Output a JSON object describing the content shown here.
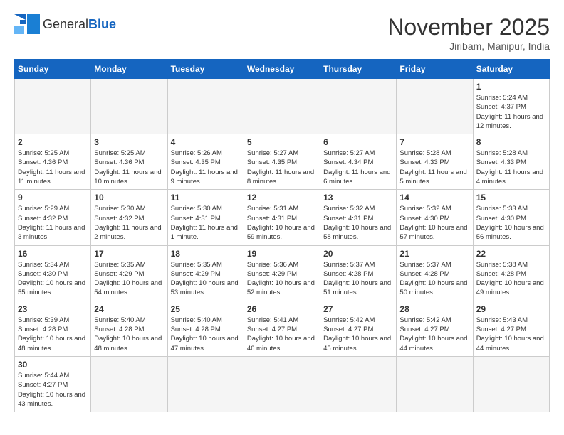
{
  "header": {
    "logo_general": "General",
    "logo_blue": "Blue",
    "month_title": "November 2025",
    "location": "Jiribam, Manipur, India"
  },
  "weekdays": [
    "Sunday",
    "Monday",
    "Tuesday",
    "Wednesday",
    "Thursday",
    "Friday",
    "Saturday"
  ],
  "weeks": [
    [
      {
        "day": "",
        "empty": true
      },
      {
        "day": "",
        "empty": true
      },
      {
        "day": "",
        "empty": true
      },
      {
        "day": "",
        "empty": true
      },
      {
        "day": "",
        "empty": true
      },
      {
        "day": "",
        "empty": true
      },
      {
        "day": "1",
        "info": "Sunrise: 5:24 AM\nSunset: 4:37 PM\nDaylight: 11 hours and 12 minutes."
      }
    ],
    [
      {
        "day": "2",
        "info": "Sunrise: 5:25 AM\nSunset: 4:36 PM\nDaylight: 11 hours and 11 minutes."
      },
      {
        "day": "3",
        "info": "Sunrise: 5:25 AM\nSunset: 4:36 PM\nDaylight: 11 hours and 10 minutes."
      },
      {
        "day": "4",
        "info": "Sunrise: 5:26 AM\nSunset: 4:35 PM\nDaylight: 11 hours and 9 minutes."
      },
      {
        "day": "5",
        "info": "Sunrise: 5:27 AM\nSunset: 4:35 PM\nDaylight: 11 hours and 8 minutes."
      },
      {
        "day": "6",
        "info": "Sunrise: 5:27 AM\nSunset: 4:34 PM\nDaylight: 11 hours and 6 minutes."
      },
      {
        "day": "7",
        "info": "Sunrise: 5:28 AM\nSunset: 4:33 PM\nDaylight: 11 hours and 5 minutes."
      },
      {
        "day": "8",
        "info": "Sunrise: 5:28 AM\nSunset: 4:33 PM\nDaylight: 11 hours and 4 minutes."
      }
    ],
    [
      {
        "day": "9",
        "info": "Sunrise: 5:29 AM\nSunset: 4:32 PM\nDaylight: 11 hours and 3 minutes."
      },
      {
        "day": "10",
        "info": "Sunrise: 5:30 AM\nSunset: 4:32 PM\nDaylight: 11 hours and 2 minutes."
      },
      {
        "day": "11",
        "info": "Sunrise: 5:30 AM\nSunset: 4:31 PM\nDaylight: 11 hours and 1 minute."
      },
      {
        "day": "12",
        "info": "Sunrise: 5:31 AM\nSunset: 4:31 PM\nDaylight: 10 hours and 59 minutes."
      },
      {
        "day": "13",
        "info": "Sunrise: 5:32 AM\nSunset: 4:31 PM\nDaylight: 10 hours and 58 minutes."
      },
      {
        "day": "14",
        "info": "Sunrise: 5:32 AM\nSunset: 4:30 PM\nDaylight: 10 hours and 57 minutes."
      },
      {
        "day": "15",
        "info": "Sunrise: 5:33 AM\nSunset: 4:30 PM\nDaylight: 10 hours and 56 minutes."
      }
    ],
    [
      {
        "day": "16",
        "info": "Sunrise: 5:34 AM\nSunset: 4:30 PM\nDaylight: 10 hours and 55 minutes."
      },
      {
        "day": "17",
        "info": "Sunrise: 5:35 AM\nSunset: 4:29 PM\nDaylight: 10 hours and 54 minutes."
      },
      {
        "day": "18",
        "info": "Sunrise: 5:35 AM\nSunset: 4:29 PM\nDaylight: 10 hours and 53 minutes."
      },
      {
        "day": "19",
        "info": "Sunrise: 5:36 AM\nSunset: 4:29 PM\nDaylight: 10 hours and 52 minutes."
      },
      {
        "day": "20",
        "info": "Sunrise: 5:37 AM\nSunset: 4:28 PM\nDaylight: 10 hours and 51 minutes."
      },
      {
        "day": "21",
        "info": "Sunrise: 5:37 AM\nSunset: 4:28 PM\nDaylight: 10 hours and 50 minutes."
      },
      {
        "day": "22",
        "info": "Sunrise: 5:38 AM\nSunset: 4:28 PM\nDaylight: 10 hours and 49 minutes."
      }
    ],
    [
      {
        "day": "23",
        "info": "Sunrise: 5:39 AM\nSunset: 4:28 PM\nDaylight: 10 hours and 48 minutes."
      },
      {
        "day": "24",
        "info": "Sunrise: 5:40 AM\nSunset: 4:28 PM\nDaylight: 10 hours and 48 minutes."
      },
      {
        "day": "25",
        "info": "Sunrise: 5:40 AM\nSunset: 4:28 PM\nDaylight: 10 hours and 47 minutes."
      },
      {
        "day": "26",
        "info": "Sunrise: 5:41 AM\nSunset: 4:27 PM\nDaylight: 10 hours and 46 minutes."
      },
      {
        "day": "27",
        "info": "Sunrise: 5:42 AM\nSunset: 4:27 PM\nDaylight: 10 hours and 45 minutes."
      },
      {
        "day": "28",
        "info": "Sunrise: 5:42 AM\nSunset: 4:27 PM\nDaylight: 10 hours and 44 minutes."
      },
      {
        "day": "29",
        "info": "Sunrise: 5:43 AM\nSunset: 4:27 PM\nDaylight: 10 hours and 44 minutes."
      }
    ],
    [
      {
        "day": "30",
        "info": "Sunrise: 5:44 AM\nSunset: 4:27 PM\nDaylight: 10 hours and 43 minutes."
      },
      {
        "day": "",
        "empty": true
      },
      {
        "day": "",
        "empty": true
      },
      {
        "day": "",
        "empty": true
      },
      {
        "day": "",
        "empty": true
      },
      {
        "day": "",
        "empty": true
      },
      {
        "day": "",
        "empty": true
      }
    ]
  ]
}
